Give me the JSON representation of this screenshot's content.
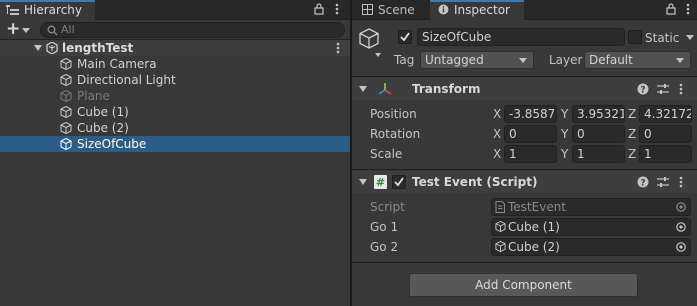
{
  "hierarchy": {
    "tab_label": "Hierarchy",
    "add_label": "+",
    "search_placeholder": "All",
    "scene_root": "lengthTest",
    "items": [
      {
        "label": "Main Camera"
      },
      {
        "label": "Directional Light"
      },
      {
        "label": "Plane"
      },
      {
        "label": "Cube (1)"
      },
      {
        "label": "Cube (2)"
      },
      {
        "label": "SizeOfCube"
      }
    ],
    "selected": "SizeOfCube"
  },
  "tabs": {
    "scene": "Scene",
    "inspector": "Inspector"
  },
  "inspector": {
    "object_name": "SizeOfCube",
    "static_label": "Static",
    "tag_label": "Tag",
    "tag_value": "Untagged",
    "layer_label": "Layer",
    "layer_value": "Default",
    "transform": {
      "title": "Transform",
      "position_label": "Position",
      "rotation_label": "Rotation",
      "scale_label": "Scale",
      "axis_x": "X",
      "axis_y": "Y",
      "axis_z": "Z",
      "position": {
        "x": "-3.8587",
        "y": "3.95321",
        "z": "4.32172"
      },
      "rotation": {
        "x": "0",
        "y": "0",
        "z": "0"
      },
      "scale": {
        "x": "1",
        "y": "1",
        "z": "1"
      }
    },
    "script_component": {
      "title": "Test Event (Script)",
      "script_label": "Script",
      "script_value": "TestEvent",
      "go1_label": "Go 1",
      "go1_value": "Cube (1)",
      "go2_label": "Go 2",
      "go2_value": "Cube (2)"
    },
    "add_component": "Add Component"
  },
  "colors": {
    "selection": "#2c5d87",
    "accent": "#3a79bb"
  }
}
